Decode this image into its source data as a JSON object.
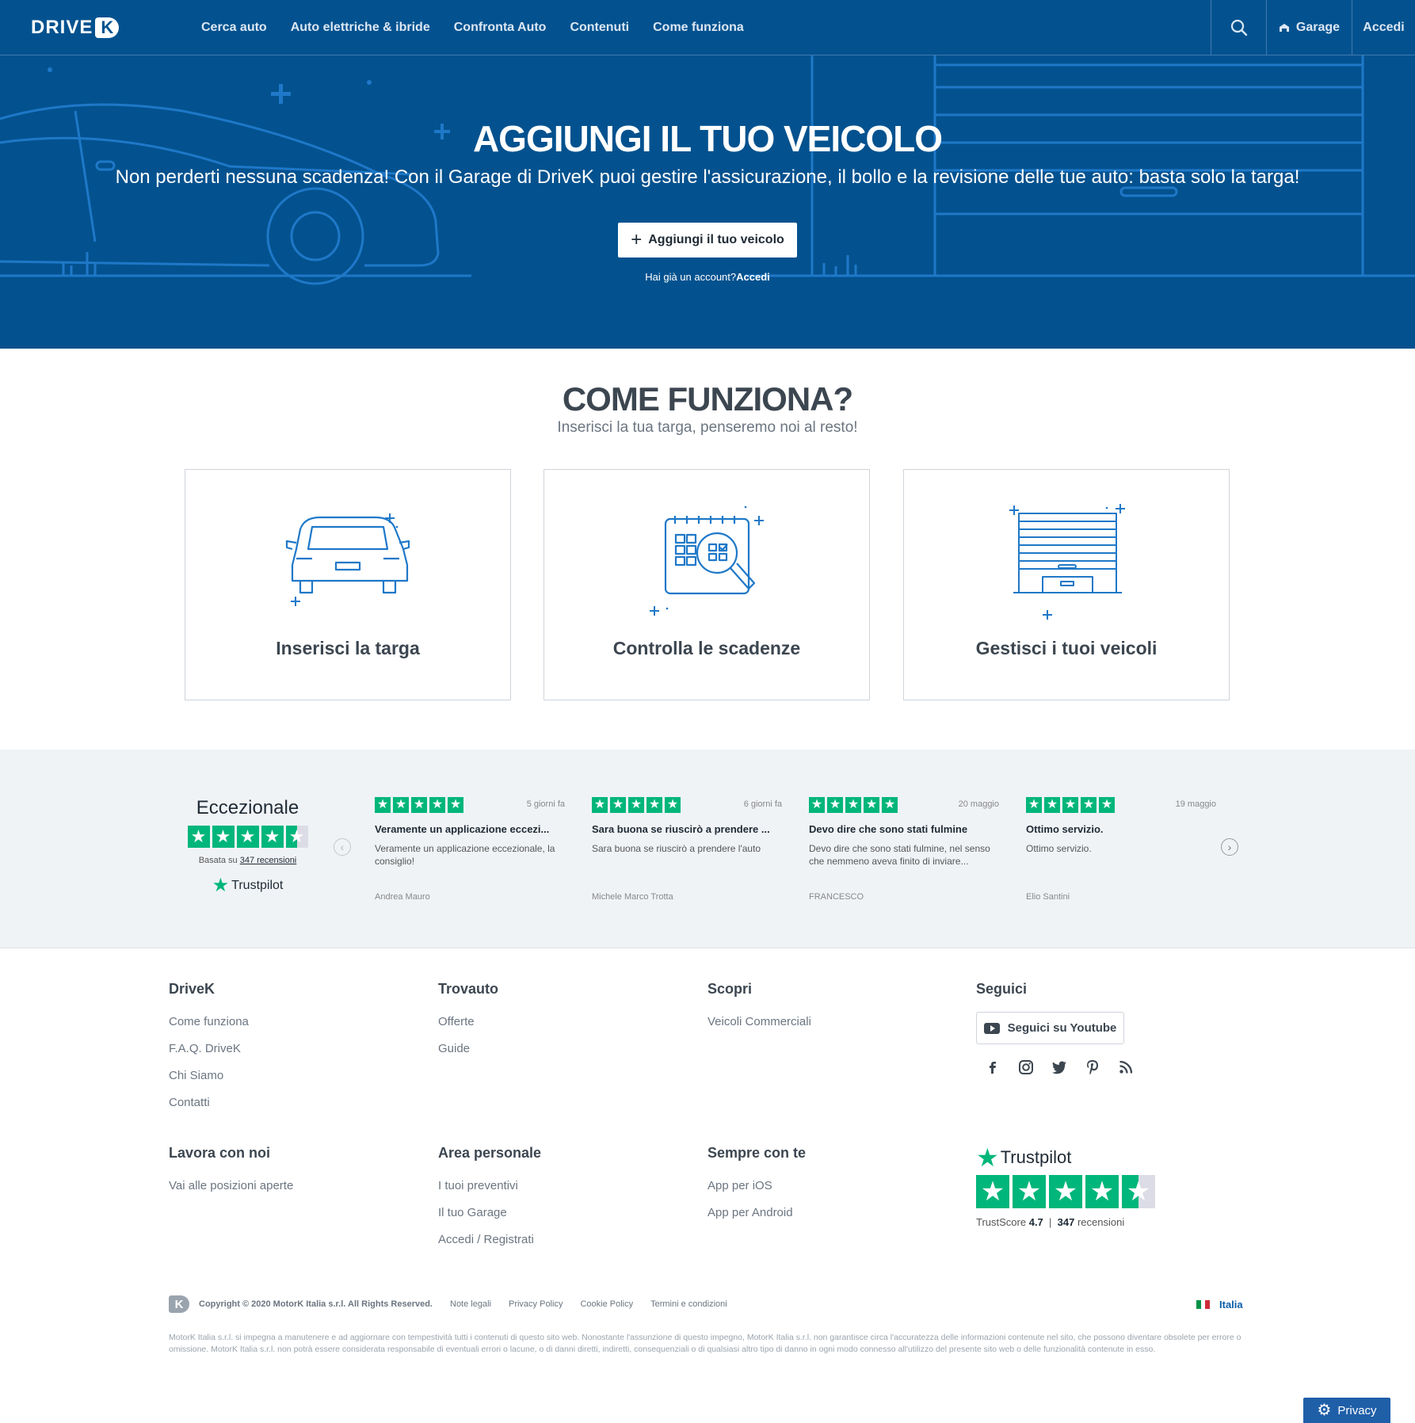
{
  "nav": {
    "logo_text": "DRIVE",
    "logo_mark": "K",
    "links": [
      "Cerca auto",
      "Auto elettriche & ibride",
      "Confronta Auto",
      "Contenuti",
      "Come funziona"
    ],
    "search_icon": "search-icon",
    "garage_label": "Garage",
    "accedi_label": "Accedi"
  },
  "hero": {
    "title": "AGGIUNGI IL TUO VEICOLO",
    "subtitle": "Non perderti nessuna scadenza! Con il Garage di DriveK puoi gestire l'assicurazione, il bollo e la revisione delle tue auto: basta solo la targa!",
    "button_label": "Aggiungi il tuo veicolo",
    "account_text": "Hai già un account?",
    "account_link": "Accedi"
  },
  "how": {
    "title": "COME FUNZIONA?",
    "subtitle": "Inserisci la tua targa, penseremo noi al resto!",
    "cards": [
      {
        "label": "Inserisci la targa",
        "icon": "car-icon"
      },
      {
        "label": "Controlla le scadenze",
        "icon": "calendar-magnifier-icon"
      },
      {
        "label": "Gestisci i tuoi veicoli",
        "icon": "garage-icon"
      }
    ]
  },
  "trustpilot": {
    "rating_word": "Eccezionale",
    "based_on": "Basata su",
    "reviews_count_label": "347 recensioni",
    "brand": "Trustpilot",
    "stars": 4.5,
    "reviews": [
      {
        "date": "5 giorni fa",
        "title": "Veramente un applicazione eccezi...",
        "body": "Veramente un applicazione eccezionale, la consiglio!",
        "author": "Andrea Mauro",
        "stars": 5
      },
      {
        "date": "6 giorni fa",
        "title": "Sara buona se riuscirò a prendere ...",
        "body": "Sara buona se riuscirò a prendere l'auto",
        "author": "Michele Marco Trotta",
        "stars": 5
      },
      {
        "date": "20 maggio",
        "title": "Devo dire che sono stati fulmine",
        "body": "Devo dire che sono stati fulmine, nel senso che nemmeno aveva finito di inviare...",
        "author": "FRANCESCO",
        "stars": 5
      },
      {
        "date": "19 maggio",
        "title": "Ottimo servizio.",
        "body": "Ottimo servizio.",
        "author": "Elio Santini",
        "stars": 5
      }
    ]
  },
  "footer": {
    "columns": [
      {
        "title": "DriveK",
        "links": [
          "Come funziona",
          "F.A.Q. DriveK",
          "Chi Siamo",
          "Contatti"
        ]
      },
      {
        "title": "Trovauto",
        "links": [
          "Offerte",
          "Guide"
        ]
      },
      {
        "title": "Scopri",
        "links": [
          "Veicoli Commerciali"
        ]
      },
      {
        "title": "Lavora con noi",
        "links": [
          "Vai alle posizioni aperte"
        ]
      },
      {
        "title": "Area personale",
        "links": [
          "I tuoi preventivi",
          "Il tuo Garage",
          "Accedi / Registrati"
        ]
      },
      {
        "title": "Sempre con te",
        "links": [
          "App per iOS",
          "App per Android"
        ]
      }
    ],
    "follow_title": "Seguici",
    "youtube_label": "Seguici su Youtube",
    "socials": [
      "facebook-icon",
      "instagram-icon",
      "twitter-icon",
      "pinterest-icon",
      "rss-icon"
    ],
    "tp_brand": "Trustpilot",
    "tp_trustscore_label": "TrustScore",
    "tp_trustscore": "4.7",
    "tp_count": "347",
    "tp_reviews_word": "recensioni",
    "copyright": "Copyright © 2020 MotorK Italia s.r.l. All Rights Reserved.",
    "legal_links": [
      "Note legali",
      "Privacy Policy",
      "Cookie Policy",
      "Termini e condizioni"
    ],
    "country": "Italia",
    "disclaimer": "MotorK Italia s.r.l. si impegna a manutenere e ad aggiornare con tempestività tutti i contenuti di questo sito web. Nonostante l'assunzione di questo impegno, MotorK Italia s.r.l. non garantisce circa l'accuratezza delle informazioni contenute nel sito, che possono diventare obsolete per errore o omissione. MotorK Italia s.r.l. non potrà essere considerata responsabile di eventuali errori o lacune, o di danni diretti, indiretti, consequenziali o di qualsiasi altro tipo di danno in ogni modo connesso all'utilizzo del presente sito web o delle funzionalità contenute in esso."
  },
  "privacy_button": "Privacy",
  "colors": {
    "brand_blue": "#03528f",
    "trustpilot_green": "#00b67a",
    "link_blue": "#0a5ea8"
  }
}
